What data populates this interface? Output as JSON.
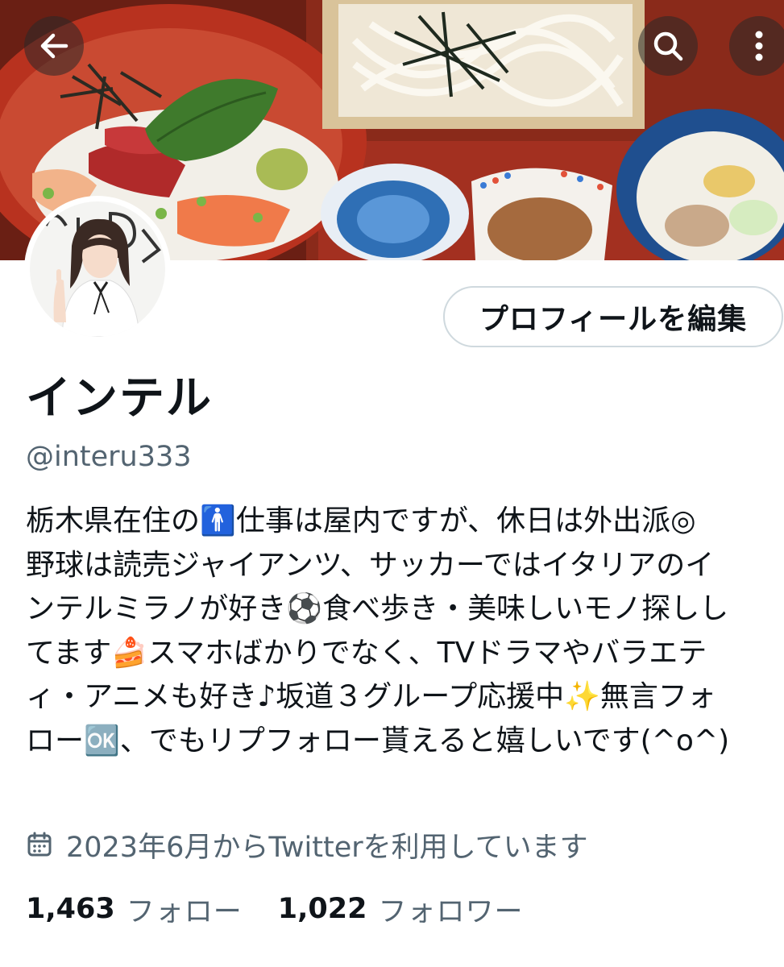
{
  "header": {
    "back_icon": "arrow-left-icon",
    "search_icon": "search-icon",
    "more_icon": "more-vertical-icon"
  },
  "profile": {
    "edit_button_label": "プロフィールを編集",
    "display_name": "インテル",
    "handle": "@interu333",
    "bio_lines": [
      "栃木県在住の🚹仕事は屋内ですが、休日は外出派◎",
      "野球は読売ジャイアンツ、サッカーではイタリアのイ",
      "ンテルミラノが好き⚽食べ歩き・美味しいモノ探しし",
      "てます🍰スマホばかりでなく、TVドラマやバラエテ",
      "ィ・アニメも好き♪坂道３グループ応援中✨無言フォ",
      "ロー🆗、でもリプフォロー貰えると嬉しいです(^o^)"
    ],
    "joined_text": "2023年6月からTwitterを利用しています",
    "joined_icon": "calendar-icon",
    "following_count": "1,463",
    "following_label": "フォロー",
    "followers_count": "1,022",
    "followers_label": "フォロワー"
  },
  "colors": {
    "secondary_text": "#536471",
    "primary_text": "#0f1419",
    "border": "#cfd9de"
  }
}
